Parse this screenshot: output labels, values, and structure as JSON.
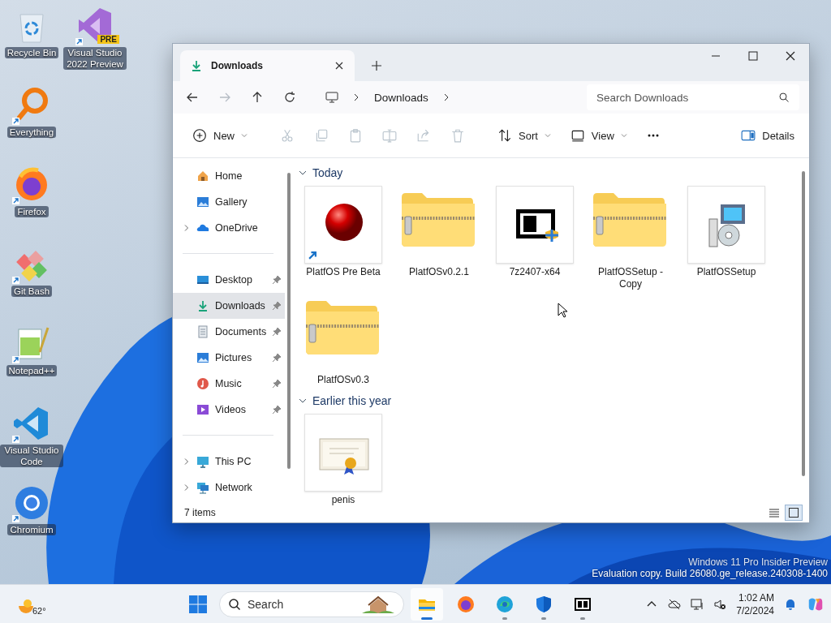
{
  "desktop_icon_columns": [
    {
      "icons": [
        {
          "label": "Recycle Bin",
          "kind": "recycle",
          "shortcut": false
        },
        {
          "label": "Everything",
          "kind": "everything",
          "shortcut": true
        },
        {
          "label": "Firefox",
          "kind": "firefox",
          "shortcut": true
        },
        {
          "label": "Git Bash",
          "kind": "gitbash",
          "shortcut": true
        },
        {
          "label": "Notepad++",
          "kind": "notepad",
          "shortcut": true
        },
        {
          "label": "Visual Studio Code",
          "kind": "vscode",
          "shortcut": true
        },
        {
          "label": "Chromium",
          "kind": "chromium",
          "shortcut": true
        }
      ]
    },
    {
      "icons": [
        {
          "label": "Visual Studio 2022 Preview",
          "kind": "vs",
          "shortcut": true,
          "badge": "PRE"
        }
      ]
    }
  ],
  "window": {
    "tabs": [
      {
        "title": "Downloads",
        "selected": true
      }
    ],
    "breadcrumb": [
      "Downloads"
    ],
    "search": {
      "placeholder": "Search Downloads"
    },
    "toolbar": [
      {
        "kind": "new",
        "label": "New",
        "dropdown": true,
        "disabled": false
      },
      {
        "kind": "cut",
        "disabled": true
      },
      {
        "kind": "copy",
        "disabled": true
      },
      {
        "kind": "paste",
        "disabled": true
      },
      {
        "kind": "rename",
        "disabled": true
      },
      {
        "kind": "share",
        "disabled": true
      },
      {
        "kind": "delete",
        "disabled": true
      },
      {
        "kind": "sort",
        "label": "Sort",
        "dropdown": true,
        "disabled": false
      },
      {
        "kind": "view",
        "label": "View",
        "dropdown": true,
        "disabled": false
      },
      {
        "kind": "more",
        "disabled": false
      },
      {
        "kind": "details",
        "label": "Details",
        "dropdown": false,
        "disabled": false
      }
    ],
    "sidebar": {
      "groups": [
        {
          "items": [
            {
              "label": "Home",
              "kind": "home",
              "expandable": false,
              "pinned": false,
              "selected": false
            },
            {
              "label": "Gallery",
              "kind": "gallery",
              "expandable": false,
              "pinned": false,
              "selected": false
            },
            {
              "label": "OneDrive",
              "kind": "onedrive",
              "expandable": true,
              "pinned": false,
              "selected": false
            }
          ]
        },
        {
          "items": [
            {
              "label": "Desktop",
              "kind": "desktop",
              "expandable": false,
              "pinned": true,
              "selected": false
            },
            {
              "label": "Downloads",
              "kind": "downloads",
              "expandable": false,
              "pinned": true,
              "selected": true
            },
            {
              "label": "Documents",
              "kind": "documents",
              "expandable": false,
              "pinned": true,
              "selected": false
            },
            {
              "label": "Pictures",
              "kind": "pictures",
              "expandable": false,
              "pinned": true,
              "selected": false
            },
            {
              "label": "Music",
              "kind": "music",
              "expandable": false,
              "pinned": true,
              "selected": false
            },
            {
              "label": "Videos",
              "kind": "videos",
              "expandable": false,
              "pinned": true,
              "selected": false
            }
          ]
        },
        {
          "items": [
            {
              "label": "This PC",
              "kind": "thispc",
              "expandable": true,
              "pinned": false,
              "selected": false
            },
            {
              "label": "Network",
              "kind": "network",
              "expandable": true,
              "pinned": false,
              "selected": false
            }
          ]
        }
      ]
    },
    "groups": [
      {
        "title": "Today",
        "expanded": true,
        "files": [
          {
            "name": "PlatfOS Pre Beta",
            "kind": "redball",
            "shortcut": true
          },
          {
            "name": "PlatfOSv0.2.1",
            "kind": "zip",
            "shortcut": false
          },
          {
            "name": "7z2407-x64",
            "kind": "sevenzip",
            "shortcut": false
          },
          {
            "name": "PlatfOSSetup - Copy",
            "kind": "zip",
            "shortcut": false
          },
          {
            "name": "PlatfOSSetup",
            "kind": "installer",
            "shortcut": false
          },
          {
            "name": "PlatfOSv0.3",
            "kind": "zip",
            "shortcut": false
          }
        ]
      },
      {
        "title": "Earlier this year",
        "expanded": true,
        "files": [
          {
            "name": "penis",
            "kind": "certificate",
            "shortcut": false
          }
        ]
      }
    ],
    "status": "7 items",
    "view_modes": [
      {
        "kind": "details",
        "selected": false
      },
      {
        "kind": "tiles",
        "selected": true
      }
    ]
  },
  "watermark": [
    "Windows 11 Pro Insider Preview",
    "Evaluation copy. Build 26080.ge_release.240308-1400"
  ],
  "taskbar": {
    "weather": "62°",
    "search": {
      "placeholder": "Search"
    },
    "apps": [
      {
        "kind": "explorer",
        "active": true,
        "running": true
      },
      {
        "kind": "firefox",
        "active": false,
        "running": false
      },
      {
        "kind": "edge",
        "active": false,
        "running": true
      },
      {
        "kind": "defender",
        "active": false,
        "running": true
      },
      {
        "kind": "sevenzip",
        "active": false,
        "running": true
      }
    ],
    "time": "1:02 AM",
    "date": "7/2/2024"
  }
}
